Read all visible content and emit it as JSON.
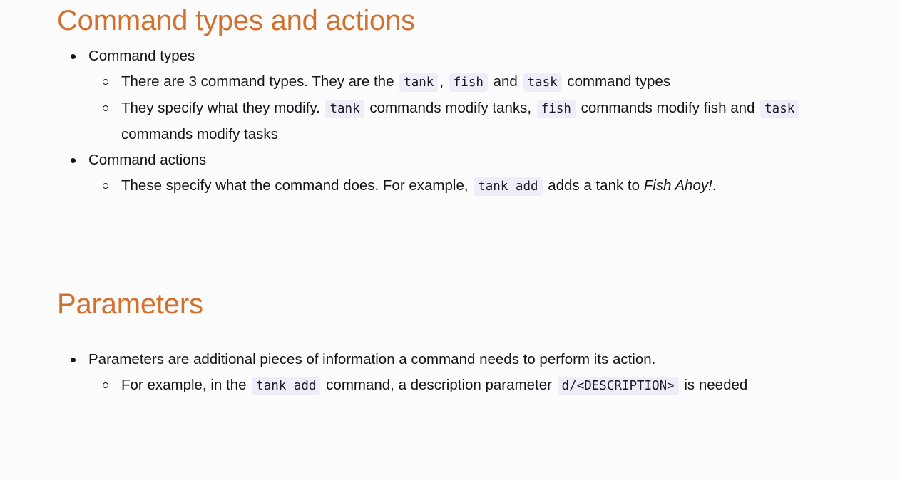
{
  "page": {
    "background_color": "#fcfcfd",
    "text_color": "#111418",
    "heading_color": "#d2712e",
    "code_chip_background": "#eeeef8"
  },
  "sections": [
    {
      "heading": "Command types and actions",
      "items": [
        {
          "label": "Command types",
          "children": [
            {
              "parts": [
                {
                  "type": "text",
                  "value": "There are 3 command types. They are the "
                },
                {
                  "type": "code",
                  "value": "tank"
                },
                {
                  "type": "text",
                  "value": ", "
                },
                {
                  "type": "code",
                  "value": "fish"
                },
                {
                  "type": "text",
                  "value": " and "
                },
                {
                  "type": "code",
                  "value": "task"
                },
                {
                  "type": "text",
                  "value": " command types"
                }
              ]
            },
            {
              "parts": [
                {
                  "type": "text",
                  "value": "They specify what they modify. "
                },
                {
                  "type": "code",
                  "value": "tank"
                },
                {
                  "type": "text",
                  "value": " commands modify tanks, "
                },
                {
                  "type": "code",
                  "value": "fish"
                },
                {
                  "type": "text",
                  "value": " commands modify fish and "
                },
                {
                  "type": "code",
                  "value": "task"
                },
                {
                  "type": "text",
                  "value": " commands modify tasks"
                }
              ]
            }
          ]
        },
        {
          "label": "Command actions",
          "children": [
            {
              "parts": [
                {
                  "type": "text",
                  "value": "These specify what the command does. For example, "
                },
                {
                  "type": "code",
                  "value": "tank add"
                },
                {
                  "type": "text",
                  "value": " adds a tank to "
                },
                {
                  "type": "italic",
                  "value": "Fish Ahoy!"
                },
                {
                  "type": "text",
                  "value": "."
                }
              ]
            }
          ]
        }
      ]
    },
    {
      "heading": "Parameters",
      "items": [
        {
          "label": "Parameters are additional pieces of information a command needs to perform its action.",
          "children": [
            {
              "parts": [
                {
                  "type": "text",
                  "value": "For example, in the "
                },
                {
                  "type": "code",
                  "value": "tank add"
                },
                {
                  "type": "text",
                  "value": " command, a description parameter "
                },
                {
                  "type": "code",
                  "value": "d/<DESCRIPTION>"
                },
                {
                  "type": "text",
                  "value": " is needed"
                }
              ]
            }
          ]
        }
      ]
    }
  ]
}
